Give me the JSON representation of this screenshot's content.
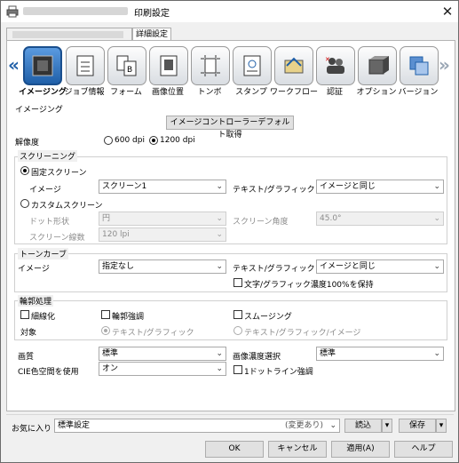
{
  "window": {
    "title": "印刷設定",
    "close_icon": "close-icon"
  },
  "tabs": [
    {
      "label": "詳細設定"
    }
  ],
  "toolbar": {
    "items": [
      {
        "label": "イメージング",
        "icon": "imaging-icon",
        "selected": true
      },
      {
        "label": "ジョブ情報",
        "icon": "job-info-icon"
      },
      {
        "label": "フォーム",
        "icon": "form-icon"
      },
      {
        "label": "画像位置",
        "icon": "image-position-icon"
      },
      {
        "label": "トンボ",
        "icon": "crop-marks-icon"
      },
      {
        "label": "スタンプ",
        "icon": "stamp-icon"
      },
      {
        "label": "ワークフロー",
        "icon": "workflow-icon"
      },
      {
        "label": "認証",
        "icon": "authentication-icon"
      },
      {
        "label": "オプション",
        "icon": "option-icon"
      },
      {
        "label": "バージョン",
        "icon": "version-icon"
      }
    ]
  },
  "imaging": {
    "section_label": "イメージング",
    "default_button": "イメージコントローラーデフォルト取得",
    "resolution": {
      "label": "解像度",
      "opt1": "600 dpi",
      "opt2": "1200 dpi"
    }
  },
  "screening": {
    "label": "スクリーニング",
    "fixed_label": "固定スクリーン",
    "image_label": "イメージ",
    "image_value": "スクリーン1",
    "text_graphic_label": "テキスト/グラフィック",
    "text_graphic_value": "イメージと同じ",
    "custom_label": "カスタムスクリーン",
    "dot_shape_label": "ドット形状",
    "dot_shape_value": "円",
    "screen_angle_label": "スクリーン角度",
    "screen_angle_value": "45.0°",
    "screen_lines_label": "スクリーン線数",
    "screen_lines_value": "120 lpi"
  },
  "tone": {
    "label": "トーンカーブ",
    "image_label": "イメージ",
    "image_value": "指定なし",
    "text_graphic_label": "テキスト/グラフィック",
    "text_graphic_value": "イメージと同じ",
    "keep_label": "文字/グラフィック濃度100%を保持"
  },
  "edge": {
    "label": "輪郭処理",
    "thin_label": "細線化",
    "enhance_label": "輪郭強調",
    "smoothing_label": "スムージング",
    "target_label": "対象",
    "target_opt1": "テキスト/グラフィック",
    "target_opt2": "テキスト/グラフィック/イメージ"
  },
  "quality": {
    "label": "画質",
    "value": "標準",
    "density_label": "画像濃度選択",
    "density_value": "標準",
    "cie_label": "CIE色空間を使用",
    "cie_value": "オン",
    "dotline_label": "1ドットライン強調"
  },
  "favorites": {
    "label": "お気に入り",
    "value": "標準設定",
    "changed": "(変更あり)",
    "load": "読込",
    "save": "保存"
  },
  "footer": {
    "ok": "OK",
    "cancel": "キャンセル",
    "apply": "適用(A)",
    "help": "ヘルプ"
  }
}
